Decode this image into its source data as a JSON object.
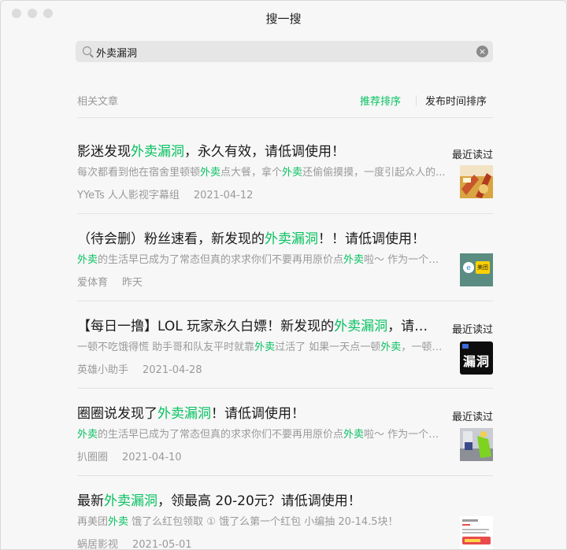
{
  "window": {
    "title": "搜一搜"
  },
  "search": {
    "query": "外卖漏洞",
    "placeholder": "搜索"
  },
  "filter": {
    "label": "相关文章",
    "sort_recommended": "推荐排序",
    "sort_time": "发布时间排序"
  },
  "colors": {
    "highlight": "#07c160",
    "muted": "#9a9a9a",
    "text": "#1a1a1a"
  },
  "results": [
    {
      "title_pre": "影迷发现",
      "title_hl": "外卖漏洞",
      "title_post": "，永久有效，请低调使用！",
      "snippet_pre": "每次都看到他在宿舍里顿顿",
      "snippet_hl1": "外卖",
      "snippet_mid": "点大餐，拿个",
      "snippet_hl2": "外卖",
      "snippet_post": "还偷偷摸摸，一度引起众人的...",
      "source": "YYeTs 人人影视字幕组",
      "date": "2021-04-12",
      "recent": "最近读过",
      "thumb_icon": "food-photo"
    },
    {
      "title_pre": "（待会删）粉丝速看，新发现的",
      "title_hl": "外卖漏洞",
      "title_post": "！！请低调使用！",
      "snippet_pre": "",
      "snippet_hl1": "外卖",
      "snippet_mid": "的生活早已成为了常态但真的求求你们不要再用原价点",
      "snippet_hl2": "外卖",
      "snippet_post": "啦～ 作为一个幸...",
      "source": "爱体育",
      "date": "昨天",
      "recent": "",
      "thumb_icon": "meituan-logo",
      "thumb_text": "美团"
    },
    {
      "title_pre": "【每日一撸】LOL 玩家永久白嫖！新发现的",
      "title_hl": "外卖漏洞",
      "title_post": "，请低调使用！",
      "snippet_pre": "一顿不吃饿得慌 助手哥和队友平时就靠",
      "snippet_hl1": "外卖",
      "snippet_mid": "过活了 如果一天点一顿",
      "snippet_hl2": "外卖",
      "snippet_post": "，一顿2...",
      "source": "英雄小助手",
      "date": "2021-04-28",
      "recent": "最近读过",
      "thumb_icon": "loophole-text-image",
      "thumb_text": "漏洞"
    },
    {
      "title_pre": "圈圈说发现了",
      "title_hl": "外卖漏洞",
      "title_post": "！请低调使用！",
      "snippet_pre": "",
      "snippet_hl1": "外卖",
      "snippet_mid": "的生活早已成为了常态但真的求求你们不要再用原价点",
      "snippet_hl2": "外卖",
      "snippet_post": "啦～ 作为一个幸...",
      "source": "扒圈圈",
      "date": "2021-04-10",
      "recent": "最近读过",
      "thumb_icon": "delivery-rider-photo"
    },
    {
      "title_pre": "最新",
      "title_hl": "外卖漏洞",
      "title_post": "，领最高 20-20元？请低调使用！",
      "snippet_pre": "再美团",
      "snippet_hl1": "外卖",
      "snippet_mid": " 饿了么红包领取 ① 饿了么第一个红包 小编抽 20-14.5块！",
      "snippet_hl2": "",
      "snippet_post": "",
      "source": "蜗居影视",
      "date": "2021-05-01",
      "recent": "",
      "thumb_icon": "coupon-screenshot"
    }
  ]
}
